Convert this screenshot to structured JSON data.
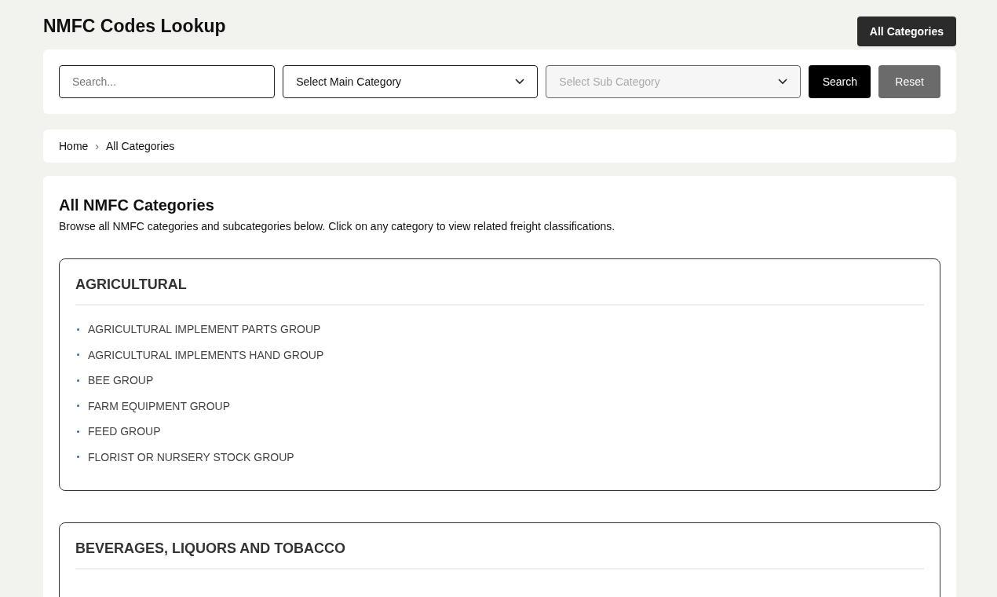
{
  "header": {
    "title": "NMFC Codes Lookup",
    "button": "All Categories"
  },
  "filters": {
    "search": {
      "placeholder": "Search..."
    },
    "selects": [
      {
        "label": "Select Main Category",
        "disabled": false
      },
      {
        "label": "Select Sub Category",
        "disabled": true
      }
    ],
    "buttons": [
      {
        "label": "Search",
        "kind": "primary"
      },
      {
        "label": "Reset",
        "kind": "secondary"
      }
    ]
  },
  "breadcrumb": [
    "Home",
    "All Categories"
  ],
  "breadcrumb_separator": "›",
  "content": {
    "title": "All NMFC Categories",
    "description": "Browse all NMFC categories and subcategories below. Click on any category to view related freight classifications.",
    "categories": [
      {
        "name": "AGRICULTURAL",
        "items": [
          "AGRICULTURAL IMPLEMENT PARTS GROUP",
          "AGRICULTURAL IMPLEMENTS HAND GROUP",
          "BEE GROUP",
          "FARM EQUIPMENT GROUP",
          "FEED GROUP",
          "FLORIST OR NURSERY STOCK GROUP"
        ]
      },
      {
        "name": "BEVERAGES, LIQUORS AND TOBACCO"
      }
    ]
  }
}
